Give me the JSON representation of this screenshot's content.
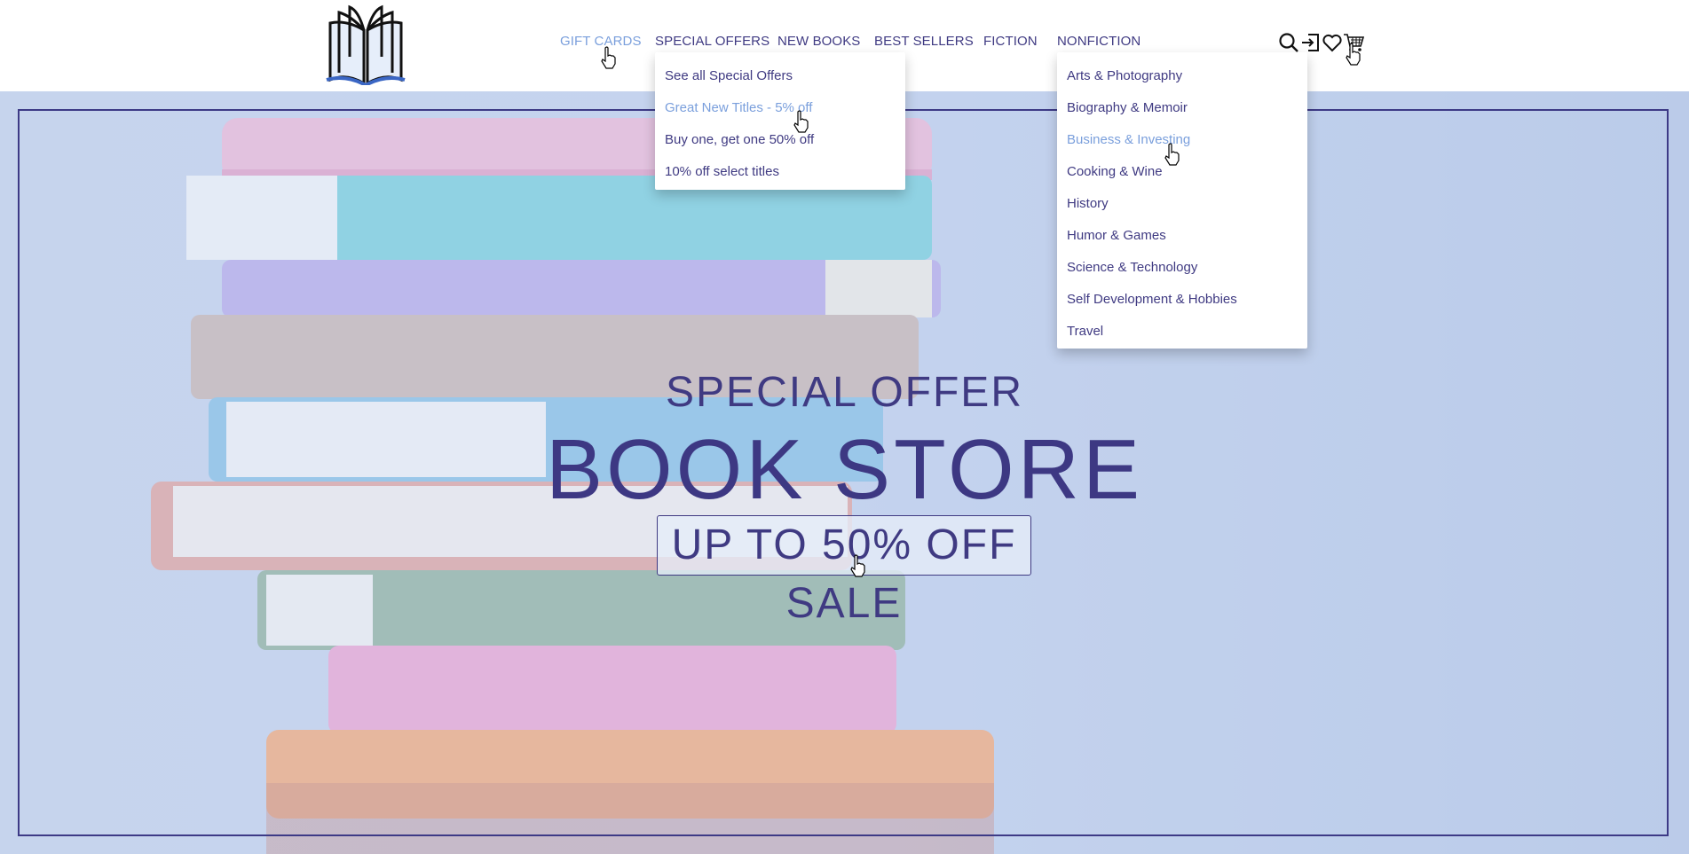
{
  "header": {
    "logo_icon": "open-book-icon",
    "nav": [
      {
        "label": "GIFT CARDS",
        "active": true
      },
      {
        "label": "SPECIAL OFFERS",
        "active": false
      },
      {
        "label": "NEW BOOKS",
        "active": false
      },
      {
        "label": "BEST SELLERS",
        "active": false
      },
      {
        "label": "FICTION",
        "active": false
      },
      {
        "label": "NONFICTION",
        "active": false
      }
    ],
    "icons": [
      "search-icon",
      "login-icon",
      "heart-icon",
      "cart-icon"
    ]
  },
  "special_offers_menu": {
    "items": [
      {
        "label": "See all Special Offers",
        "highlighted": false
      },
      {
        "label": "Great New Titles - 5% off",
        "highlighted": true
      },
      {
        "label": "Buy one, get one 50% off",
        "highlighted": false
      },
      {
        "label": "10% off select titles",
        "highlighted": false
      }
    ]
  },
  "nonfiction_menu": {
    "items": [
      {
        "label": "Arts & Photography",
        "highlighted": false
      },
      {
        "label": "Biography & Memoir",
        "highlighted": false
      },
      {
        "label": "Business & Investing",
        "highlighted": true
      },
      {
        "label": "Cooking & Wine",
        "highlighted": false
      },
      {
        "label": "History",
        "highlighted": false
      },
      {
        "label": "Humor & Games",
        "highlighted": false
      },
      {
        "label": "Science & Technology",
        "highlighted": false
      },
      {
        "label": "Self Development & Hobbies",
        "highlighted": false
      },
      {
        "label": "Travel",
        "highlighted": false
      }
    ]
  },
  "hero": {
    "subtitle": "SPECIAL OFFER",
    "title": "BOOK STORE",
    "button": "UP TO 50% OFF SALE"
  },
  "colors": {
    "brand": "#3f3a82",
    "highlight": "#7a9fdc",
    "hero_bg": "#c2d2ee"
  }
}
